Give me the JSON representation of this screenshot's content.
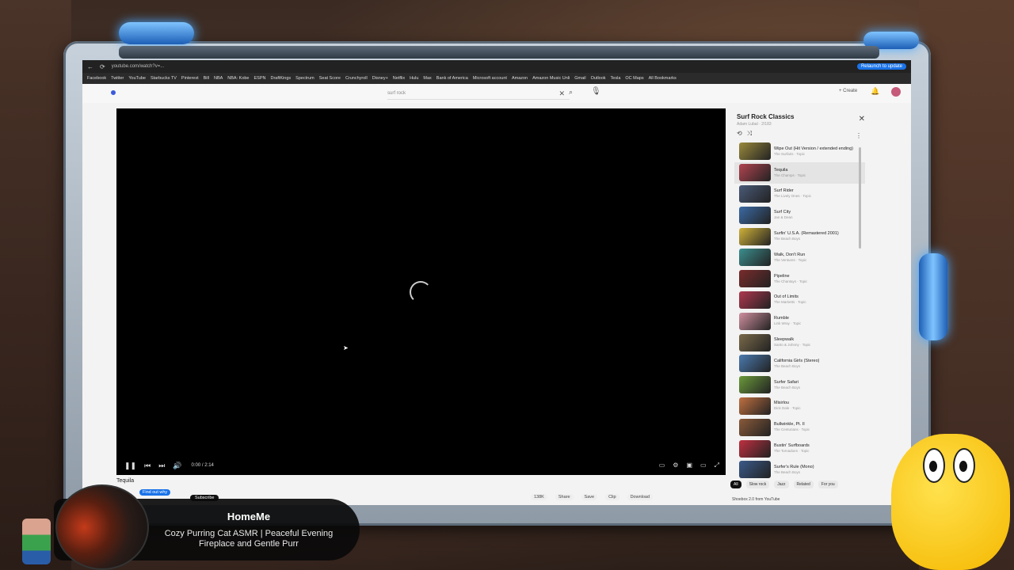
{
  "browser": {
    "url": "youtube.com/watch?v=...",
    "relaunch_label": "Relaunch to update",
    "bookmarks": [
      "Facebook",
      "Twitter",
      "YouTube",
      "Starbucks TV",
      "Pinterest",
      "Bill",
      "NBA",
      "NBA: Kobe",
      "ESPN",
      "DraftKings",
      "Spectrum",
      "Seat Score",
      "Crunchyroll",
      "Disney+",
      "Netflix",
      "Hulu",
      "Max",
      "Bank of America",
      "Microsoft account",
      "Amazon",
      "Amazon Music Unli",
      "Gmail",
      "Outlook",
      "Tesla",
      "OC Maps",
      "All Bookmarks"
    ]
  },
  "youtube": {
    "search_query": "surf rock",
    "create_label": "Create"
  },
  "player": {
    "time": "0:00 / 2:14"
  },
  "playlist": {
    "title": "Surf Rock Classics",
    "subtitle": "Adam Lubal · 2/183",
    "items": [
      {
        "title": "Wipe Out (Hit Version / extended ending)",
        "artist": "The Surfaris · Topic",
        "color": "#9a8a3c"
      },
      {
        "title": "Tequila",
        "artist": "The Champs · Topic",
        "color": "#b24450"
      },
      {
        "title": "Surf Rider",
        "artist": "The Lively Ones · Topic",
        "color": "#4a5a78"
      },
      {
        "title": "Surf City",
        "artist": "Jan & Dean",
        "color": "#3b6aa5"
      },
      {
        "title": "Surfin' U.S.A. (Remastered 2001)",
        "artist": "The Beach Boys",
        "color": "#d0b23a"
      },
      {
        "title": "Walk, Don't Run",
        "artist": "The Ventures · Topic",
        "color": "#3c8f8f"
      },
      {
        "title": "Pipeline",
        "artist": "The Chantays · Topic",
        "color": "#7a2b2b"
      },
      {
        "title": "Out of Limits",
        "artist": "The Marketts · Topic",
        "color": "#b0384f"
      },
      {
        "title": "Rumble",
        "artist": "Link Wray · Topic",
        "color": "#d090a0"
      },
      {
        "title": "Sleepwalk",
        "artist": "Santo & Johnny · Topic",
        "color": "#7a6a4a"
      },
      {
        "title": "California Girls (Stereo)",
        "artist": "The Beach Boys",
        "color": "#4a7ab0"
      },
      {
        "title": "Surfer Safari",
        "artist": "The Beach Boys",
        "color": "#6a9a3a"
      },
      {
        "title": "Misirlou",
        "artist": "Dick Dale · Topic",
        "color": "#c07040"
      },
      {
        "title": "Bullwinkle, Pt. II",
        "artist": "The Centurians · Topic",
        "color": "#8a5a3a"
      },
      {
        "title": "Bustin' Surfboards",
        "artist": "The Tornadoes · Topic",
        "color": "#c03040"
      },
      {
        "title": "Surfer's Rule (Mono)",
        "artist": "The Beach Boys",
        "color": "#3a5a8a"
      }
    ]
  },
  "chips": [
    "All",
    "Slow rock",
    "Jazz",
    "Related",
    "For you"
  ],
  "below_player": {
    "title": "Tequila",
    "find_out_label": "Find out why",
    "subscribe_label": "Subscribe",
    "actions": [
      "138K",
      "Share",
      "Save",
      "Clip",
      "Download"
    ]
  },
  "side_next": "Shoebox 2.0 from YouTube",
  "overlay": {
    "channel": "HomeMe",
    "title": "Cozy Purring Cat ASMR | Peaceful Evening Fireplace and Gentle Purr"
  }
}
